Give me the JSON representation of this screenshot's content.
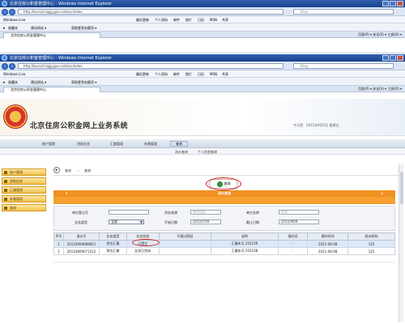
{
  "window": {
    "title": "北京住房公积金管理中心 - Windows Internet Explorer",
    "address": "http://bscsxh.bjgjj.gov.cn/bscs/index",
    "search_placeholder": "Bing",
    "menu_items": [
      "Windows Live",
      "最近更新",
      "个人资料",
      "邮件",
      "照片",
      "日历",
      "MSN",
      "共享"
    ],
    "fav_label": "收藏夹",
    "fav_items": [
      "建议网站 ▾",
      "获取更多加载项 ▾"
    ],
    "tab_title": "北京住房公积金管理中心",
    "toolbar_right": "页面(P) ▾  安全(S) ▾  工具(O) ▾"
  },
  "page": {
    "system_title": "北京住房公积金网上业务系统",
    "date_text": "今天是：2011年9月5日  星期五",
    "topnav": [
      "账户管理",
      "贷款信息",
      "汇缴管理",
      "补缴管理",
      "查询"
    ],
    "topnav_active": "查询",
    "subnav": [
      "流水查询",
      "个人信息查询"
    ],
    "sidebar": [
      "账户管理",
      "贷款信息",
      "汇缴管理",
      "补缴管理",
      "查询"
    ],
    "breadcrumb": [
      "查询",
      "查询"
    ],
    "query_button": "查询",
    "section_title": "流水查询",
    "form": {
      "unit_reg_label": "单位登记号",
      "fund_source_label": "资金来源",
      "fund_source_value": "单位自存",
      "unit_name_label": "单位名称",
      "unit_name_value": "北京",
      "biz_type_label": "业务类型",
      "biz_type_value": "全部",
      "start_date_label": "开始日期",
      "start_date_value": "20110709",
      "end_date_label": "截止日期",
      "end_date_value": "20110909"
    },
    "table": {
      "headers": [
        "序号",
        "流水号",
        "业务类型",
        "业务状态",
        "不通过原因",
        "说明",
        "操作员",
        "操作时间",
        "经办机构"
      ],
      "rows": [
        [
          "1",
          "20110909088921",
          "到位汇缴",
          "已提交",
          "",
          "汇缴年月 201109",
          "'",
          "2011-09-08",
          "125"
        ],
        [
          "2",
          "20110809071512",
          "到位汇缴",
          "业务已完成",
          "",
          "汇缴年月 201108",
          "'",
          "2011-08-08",
          "125"
        ]
      ]
    }
  }
}
